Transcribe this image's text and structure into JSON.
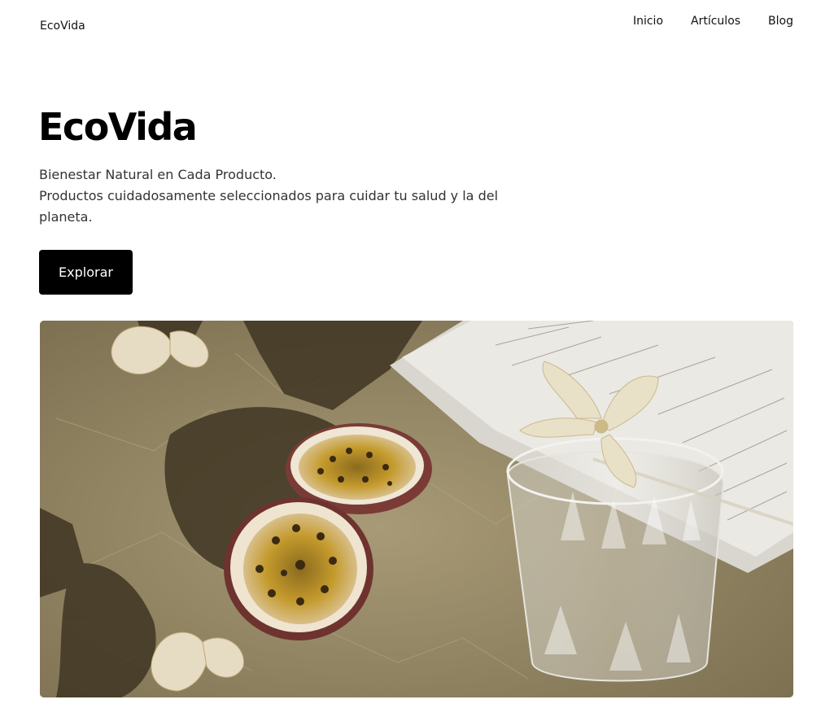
{
  "header": {
    "brand": "EcoVida",
    "nav": [
      "Inicio",
      "Artículos",
      "Blog"
    ]
  },
  "hero": {
    "title": "EcoVida",
    "lines": [
      "Bienestar Natural en Cada Producto.",
      "Productos cuidadosamente seleccionados para cuidar tu salud y la del",
      "planeta."
    ],
    "cta_label": "Explorar"
  },
  "image": {
    "subject": "passion fruit halves, dried flowers, glass tumbler and open book on crumpled kraft paper",
    "colors": {
      "paper": "#9d8f6c",
      "shadow": "#3c3220",
      "fruit": "#c9a227",
      "rind": "#7a3b36",
      "page": "#e8e6e0"
    }
  }
}
